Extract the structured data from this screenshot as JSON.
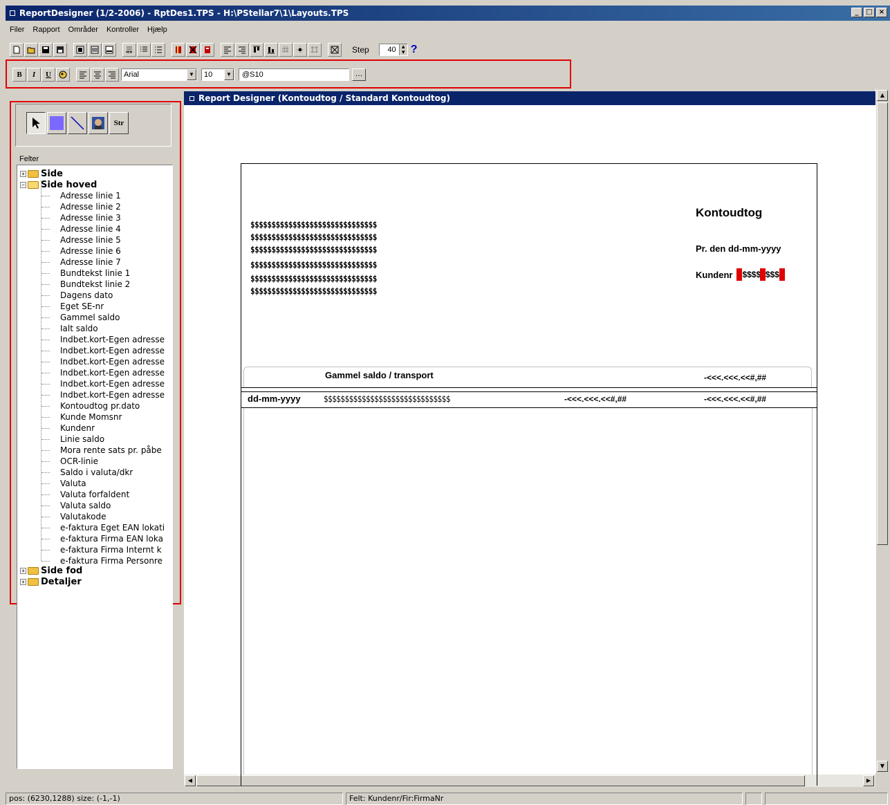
{
  "window": {
    "title": "ReportDesigner (1/2-2006) - RptDes1.TPS - H:\\PStellar7\\1\\Layouts.TPS",
    "minimize": "_",
    "maximize": "□",
    "close": "×"
  },
  "menu": [
    "Filer",
    "Rapport",
    "Områder",
    "Kontroller",
    "Hjælp"
  ],
  "toolbar": {
    "step_label": "Step",
    "step_value": "40",
    "help_label": "?"
  },
  "format_bar": {
    "bold": "B",
    "italic": "I",
    "underline": "U",
    "font": "Arial",
    "size": "10",
    "expression": "@S10",
    "browse": "..."
  },
  "tools": {
    "string_tool": "Str"
  },
  "fields_panel": {
    "header": "Felter",
    "groups": [
      {
        "label": "Side",
        "expanded": false
      },
      {
        "label": "Side hoved",
        "expanded": true
      },
      {
        "label": "Side fod",
        "expanded": false
      },
      {
        "label": "Detaljer",
        "expanded": false
      }
    ],
    "side_hoved_items": [
      "Adresse linie 1",
      "Adresse linie 2",
      "Adresse linie 3",
      "Adresse linie 4",
      "Adresse linie 5",
      "Adresse linie 6",
      "Adresse linie 7",
      "Bundtekst linie 1",
      "Bundtekst linie 2",
      "Dagens dato",
      "Eget SE-nr",
      "Gammel saldo",
      "Ialt saldo",
      "Indbet.kort-Egen adresse",
      "Indbet.kort-Egen adresse",
      "Indbet.kort-Egen adresse",
      "Indbet.kort-Egen adresse",
      "Indbet.kort-Egen adresse",
      "Indbet.kort-Egen adresse",
      "Kontoudtog pr.dato",
      "Kunde Momsnr",
      "Kundenr",
      "Linie saldo",
      "Mora rente sats pr. påbe",
      "OCR-linie",
      "Saldo i valuta/dkr",
      "Valuta",
      "Valuta forfaldent",
      "Valuta saldo",
      "Valutakode",
      "e-faktura Eget EAN lokati",
      "e-faktura Firma EAN loka",
      "e-faktura Firma Internt k",
      "e-faktura Firma Personre"
    ]
  },
  "designer": {
    "title": "Report Designer (Kontoudtog / Standard Kontoudtog)",
    "address_lines": [
      "$$$$$$$$$$$$$$$$$$$$$$$$$$$$$$",
      "$$$$$$$$$$$$$$$$$$$$$$$$$$$$$$",
      "$$$$$$$$$$$$$$$$$$$$$$$$$$$$$$",
      "$$$$$$$$$$$$$$$$$$$$$$$$$$$$$$",
      "$$$$$$$$$$$$$$$$$$$$$$$$$$$$$$",
      "$$$$$$$$$$$$$$$$$$$$$$$$$$$$$$"
    ],
    "report_title": "Kontoudtog",
    "date_label": "Pr. den dd-mm-yyyy",
    "customer_label": "Kundenr",
    "customer_value": "$$$$$$$$",
    "transport_label": "Gammel saldo / transport",
    "transport_amount": "-<<<.<<<.<<#,##",
    "detail_date": "dd-mm-yyyy",
    "detail_text": "$$$$$$$$$$$$$$$$$$$$$$$$$$$$$$",
    "detail_amount": "-<<<.<<<.<<#,##",
    "detail_balance": "-<<<.<<<.<<#,##"
  },
  "status": {
    "pos": "pos: (6230,1288)  size: (-1,-1)",
    "field": "Felt: Kundenr/Fir:FirmaNr"
  },
  "colors": {
    "titlebar": "#0a246a",
    "highlight_box": "#e00000",
    "face": "#d4d0c8"
  }
}
